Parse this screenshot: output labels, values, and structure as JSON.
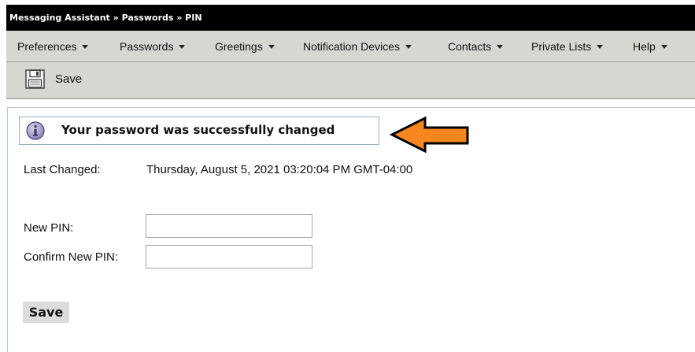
{
  "breadcrumb": "Messaging Assistant » Passwords » PIN",
  "menu": {
    "items": [
      {
        "label": "Preferences"
      },
      {
        "label": "Passwords"
      },
      {
        "label": "Greetings"
      },
      {
        "label": "Notification Devices"
      },
      {
        "label": "Contacts"
      },
      {
        "label": "Private Lists"
      },
      {
        "label": "Help"
      }
    ]
  },
  "toolbar": {
    "save_label": "Save",
    "save_icon": "floppy-disk-icon"
  },
  "message": {
    "text": "Your password was successfully changed",
    "icon": "info-icon"
  },
  "annotation": {
    "arrow_color": "#f7861e",
    "arrow_icon": "left-arrow-icon"
  },
  "form": {
    "last_changed_label": "Last Changed:",
    "last_changed_value": "Thursday, August 5, 2021 03:20:04 PM GMT-04:00",
    "new_pin_label": "New PIN:",
    "new_pin_value": "",
    "confirm_pin_label": "Confirm New PIN:",
    "confirm_pin_value": "",
    "save_button_label": "Save"
  }
}
